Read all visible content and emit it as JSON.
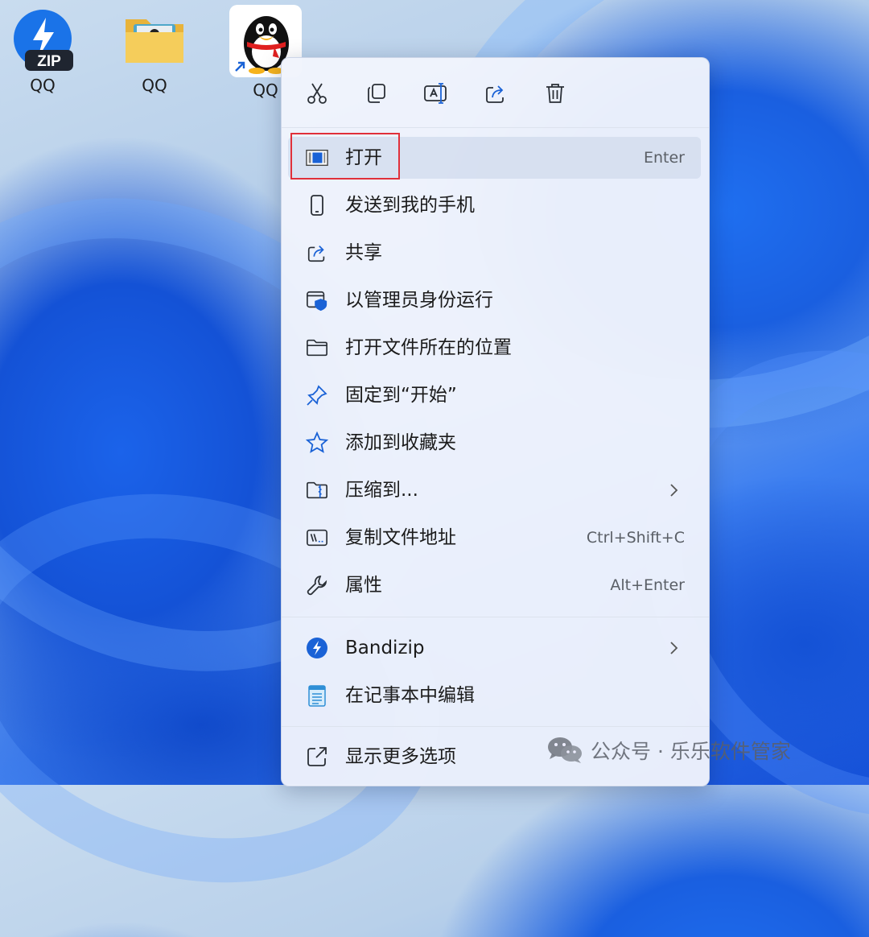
{
  "desktop": {
    "icons": [
      {
        "label": "QQ",
        "icon": "bandizip-zip-icon"
      },
      {
        "label": "QQ",
        "icon": "folder-icon"
      },
      {
        "label": "QQ",
        "icon": "qq-penguin-shortcut-icon"
      }
    ]
  },
  "context_menu": {
    "toolbar": [
      {
        "action": "cut",
        "icon": "scissors-icon"
      },
      {
        "action": "copy",
        "icon": "copy-icon"
      },
      {
        "action": "rename",
        "icon": "rename-icon"
      },
      {
        "action": "share",
        "icon": "share-icon"
      },
      {
        "action": "delete",
        "icon": "trash-icon"
      }
    ],
    "items": [
      {
        "label": "打开",
        "shortcut": "Enter",
        "icon": "open-window-icon"
      },
      {
        "label": "发送到我的手机",
        "shortcut": "",
        "icon": "phone-icon"
      },
      {
        "label": "共享",
        "shortcut": "",
        "icon": "share-icon"
      },
      {
        "label": "以管理员身份运行",
        "shortcut": "",
        "icon": "shield-window-icon"
      },
      {
        "label": "打开文件所在的位置",
        "shortcut": "",
        "icon": "folder-outline-icon"
      },
      {
        "label": "固定到“开始”",
        "shortcut": "",
        "icon": "pin-icon"
      },
      {
        "label": "添加到收藏夹",
        "shortcut": "",
        "icon": "star-icon"
      },
      {
        "label": "压缩到...",
        "shortcut": "",
        "icon": "zip-folder-icon",
        "submenu": true
      },
      {
        "label": "复制文件地址",
        "shortcut": "Ctrl+Shift+C",
        "icon": "copy-path-icon"
      },
      {
        "label": "属性",
        "shortcut": "Alt+Enter",
        "icon": "wrench-icon"
      }
    ],
    "items2": [
      {
        "label": "Bandizip",
        "icon": "bandizip-icon",
        "submenu": true
      },
      {
        "label": "在记事本中编辑",
        "icon": "notepad-icon"
      }
    ],
    "items3": [
      {
        "label": "显示更多选项",
        "icon": "more-options-icon"
      }
    ]
  },
  "watermark": {
    "text": "公众号 · 乐乐软件管家"
  },
  "colors": {
    "highlight_border": "#e0303a",
    "accent": "#1a62d6"
  }
}
